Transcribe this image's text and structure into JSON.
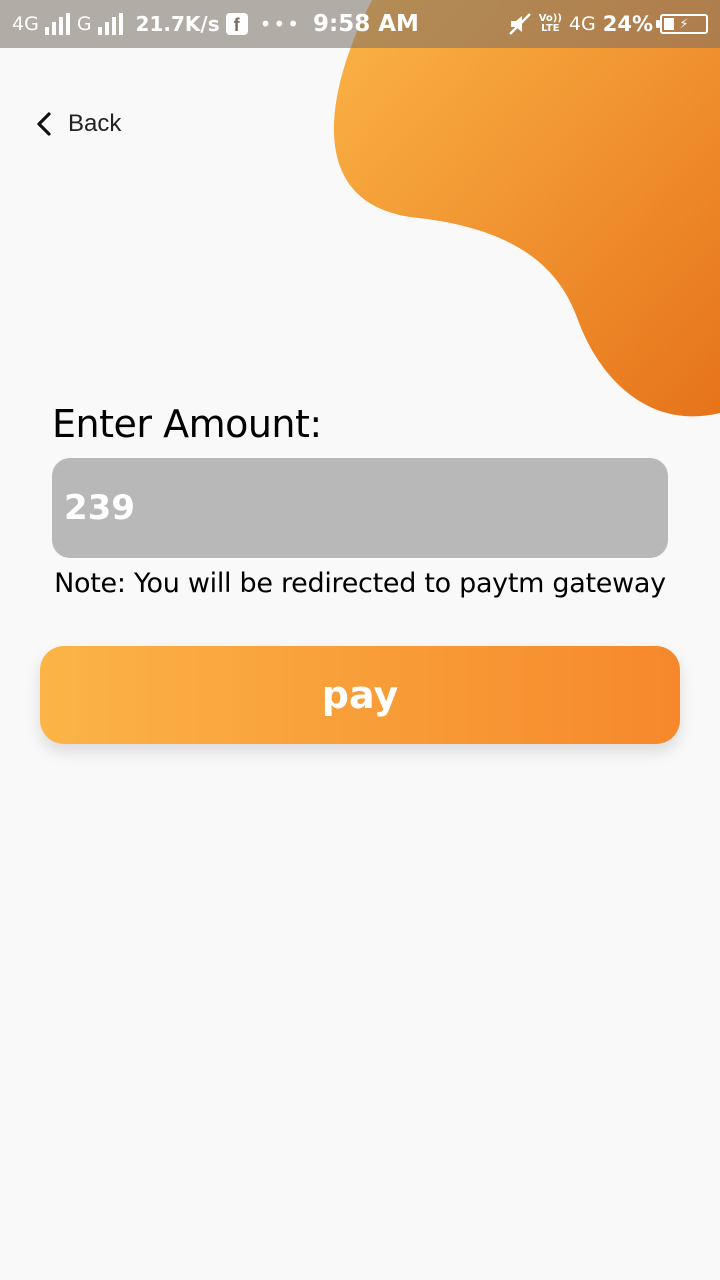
{
  "status_bar": {
    "net1": "4G",
    "net2": "G",
    "speed": "21.7K/s",
    "fb_letter": "f",
    "dots": "•••",
    "time": "9:58 AM",
    "volte_top": "Vo))",
    "volte_bottom": "LTE",
    "net3": "4G",
    "battery_percent": "24%"
  },
  "back": {
    "label": "Back"
  },
  "form": {
    "title": "Enter Amount:",
    "amount_value": "239",
    "note": "Note: You will be redirected to paytm gateway",
    "pay_label": "pay"
  },
  "colors": {
    "accent_start": "#fbb447",
    "accent_end": "#f6882b",
    "blob_start": "#fbb447",
    "blob_end": "#e6731a",
    "input_bg": "#b8b8b8"
  }
}
